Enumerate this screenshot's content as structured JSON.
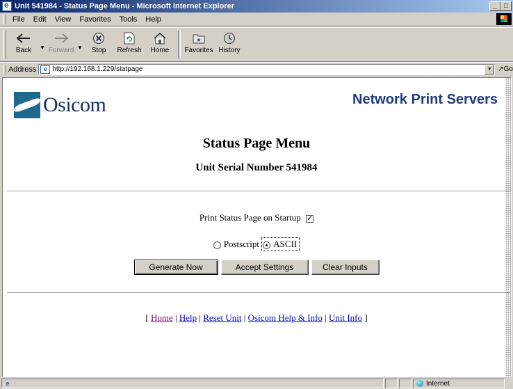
{
  "window": {
    "title": "Unit 541984 - Status Page Menu - Microsoft Internet Explorer",
    "controls": [
      "_",
      "□"
    ]
  },
  "menu": {
    "items": [
      {
        "label": "File"
      },
      {
        "label": "Edit"
      },
      {
        "label": "View"
      },
      {
        "label": "Favorites"
      },
      {
        "label": "Tools"
      },
      {
        "label": "Help"
      }
    ]
  },
  "toolbar": {
    "back": "Back",
    "forward": "Forward",
    "stop": "Stop",
    "refresh": "Refresh",
    "home": "Home",
    "favorites": "Favorites",
    "history": "History"
  },
  "address": {
    "label": "Address",
    "url": "http://192.168.1.229/statpage",
    "go": "Go"
  },
  "page": {
    "logo_text": "Osicom",
    "brand": "Network Print Servers",
    "title": "Status Page Menu",
    "serial": "Unit Serial Number 541984",
    "startup_label": "Print Status Page on Startup",
    "startup_checked": true,
    "format_options": [
      {
        "label": "Postscript",
        "selected": false
      },
      {
        "label": "ASCII",
        "selected": true
      }
    ],
    "buttons": {
      "generate": "Generate Now",
      "accept": "Accept Settings",
      "clear": "Clear Inputs"
    },
    "links": {
      "open": "[",
      "close": "]",
      "sep": "|",
      "home": "Home",
      "help": "Help",
      "reset": "Reset Unit",
      "osicom_help": "Osicom Help & Info",
      "unit_info": "Unit Info"
    }
  },
  "status": {
    "zone": "Internet"
  }
}
